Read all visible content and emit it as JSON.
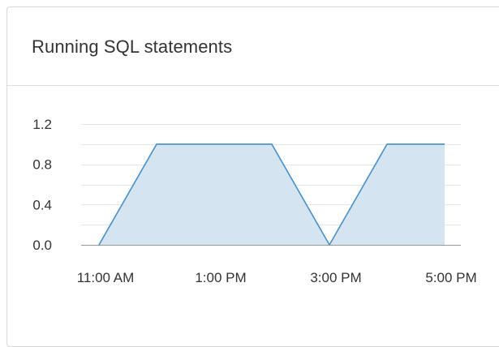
{
  "card": {
    "title": "Running SQL statements"
  },
  "chart_data": {
    "type": "area",
    "title": "",
    "xlabel": "",
    "ylabel": "",
    "x_tick_labels": [
      "11:00 AM",
      "1:00 PM",
      "3:00 PM",
      "5:00 PM"
    ],
    "y_tick_labels": [
      "1.2",
      "0.8",
      "0.4",
      "0.0"
    ],
    "y_ticks": [
      1.2,
      0.8,
      0.4,
      0.0
    ],
    "ylim": [
      0,
      1.2
    ],
    "xlim": [
      "11:00 AM",
      "5:00 PM"
    ],
    "series": [
      {
        "x": [
          "11:00 AM",
          "12:00 PM",
          "1:00 PM",
          "2:00 PM",
          "3:00 PM",
          "4:00 PM",
          "5:00 PM"
        ],
        "values": [
          0,
          1,
          1,
          1,
          0,
          1,
          1
        ]
      }
    ],
    "grid": true,
    "colors": {
      "line": "#4a90c8",
      "fill": "#d2e4f0",
      "grid": "#e6e6e6",
      "axis": "#999999"
    }
  }
}
